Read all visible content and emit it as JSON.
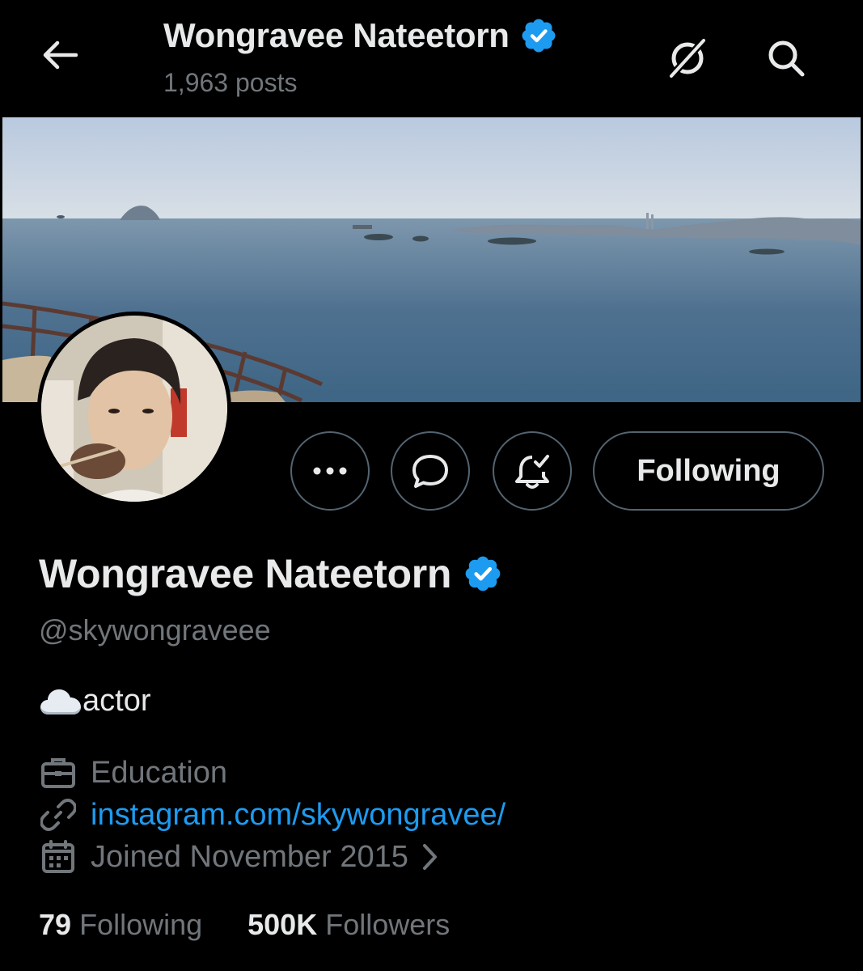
{
  "header": {
    "title": "Wongravee Nateetorn",
    "post_count": "1,963 posts"
  },
  "colors": {
    "verified_blue": "#1d9bf0",
    "link_blue": "#1d9bf0",
    "muted": "#71767b",
    "button_border": "#536471"
  },
  "icons": {
    "back": "arrow-left-icon",
    "grok": "grok-icon",
    "search": "search-icon",
    "verified": "verified-badge-icon",
    "more": "more-dots-icon",
    "message": "message-bubble-icon",
    "notifications": "bell-check-icon",
    "work": "briefcase-icon",
    "link": "link-icon",
    "calendar": "calendar-icon",
    "chevron": "chevron-right-icon",
    "cloud": "cloud-emoji"
  },
  "actions": {
    "following_label": "Following"
  },
  "profile": {
    "display_name": "Wongravee Nateetorn",
    "handle": "@skywongraveee",
    "bio_text": "actor",
    "profession": "Education",
    "website": "instagram.com/skywongravee/",
    "joined": "Joined November 2015"
  },
  "stats": {
    "following_count": "79",
    "following_label": "Following",
    "followers_count": "500K",
    "followers_label": "Followers"
  }
}
